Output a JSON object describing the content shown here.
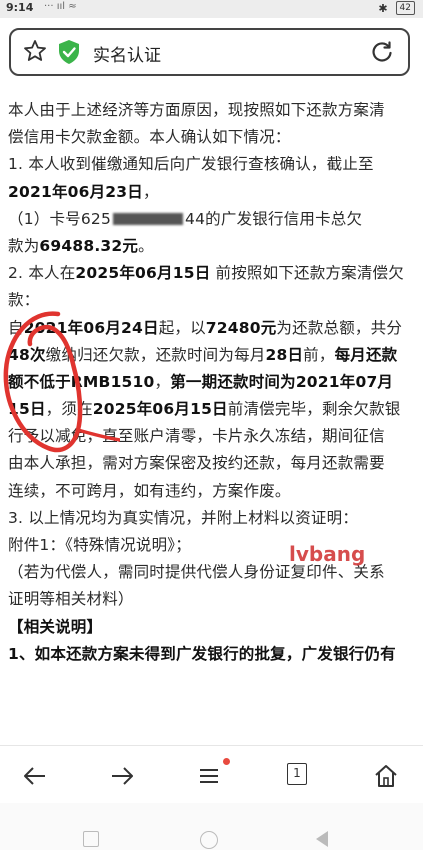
{
  "status_bar": {
    "time": "9:14",
    "signal": "··· ııl ≈",
    "battery": "42"
  },
  "address_bar": {
    "title": "实名认证",
    "shield_color": "#3bb44a"
  },
  "content": {
    "lines": [
      [
        {
          "t": "本人由于上述经济等方面原因，现按照如下还款方案清"
        }
      ],
      [
        {
          "t": "偿信用卡欠款金额。本人确认如下情况："
        }
      ],
      [
        {
          "t": "1. 本人收到催缴通知后向广发银行查核确认，截止至"
        }
      ],
      [
        {
          "t": "2021年06月23日",
          "b": true
        },
        {
          "t": "，"
        }
      ],
      [
        {
          "t": "（1）卡号625"
        },
        {
          "redact": true
        },
        {
          "t": "44的广发银行信用卡总欠"
        }
      ],
      [
        {
          "t": "款为"
        },
        {
          "t": "69488.32元",
          "b": true
        },
        {
          "t": "。"
        }
      ],
      [
        {
          "t": "2. 本人在"
        },
        {
          "t": "2025年06月15日",
          "b": true
        },
        {
          "t": " 前按照如下还款方案清偿欠"
        }
      ],
      [
        {
          "t": "款："
        }
      ],
      [
        {
          "t": "自"
        },
        {
          "t": "2021年06月24日",
          "b": true
        },
        {
          "t": "起，以"
        },
        {
          "t": "72480元",
          "b": true
        },
        {
          "t": "为还款总额，共分"
        }
      ],
      [
        {
          "t": "48次",
          "b": true
        },
        {
          "t": "缴纳归还欠款，还款时间为每月"
        },
        {
          "t": "28日",
          "b": true
        },
        {
          "t": "前，"
        },
        {
          "t": "每月还款",
          "b": true
        }
      ],
      [
        {
          "t": "额不低于RMB1510",
          "b": true
        },
        {
          "t": "，"
        },
        {
          "t": "第一期还款时间为2021年07月",
          "b": true
        }
      ],
      [
        {
          "t": "15日",
          "b": true
        },
        {
          "t": "，须在"
        },
        {
          "t": "2025年06月15日",
          "b": true
        },
        {
          "t": "前清偿完毕，剩余欠款银"
        }
      ],
      [
        {
          "t": "行予以减免，直至账户清零，卡片永久冻结，期间征信"
        }
      ],
      [
        {
          "t": "由本人承担，需对方案保密及按约还款，每月还款需要"
        }
      ],
      [
        {
          "t": "连续，不可跨月，如有违约，方案作废。"
        }
      ],
      [
        {
          "t": "3. 以上情况均为真实情况，并附上材料以资证明："
        }
      ],
      [
        {
          "t": "附件1：《特殊情况说明》；"
        }
      ],
      [
        {
          "t": "（若为代偿人，需同时提供代偿人身份证复印件、关系"
        }
      ],
      [
        {
          "t": "证明等相关材料）"
        }
      ],
      [
        {
          "t": "【相关说明】",
          "b": true
        }
      ],
      [
        {
          "t": "1、如本还款方案未得到广发银行的批复，广发银行仍有",
          "b": true
        }
      ]
    ]
  },
  "watermark": {
    "text": "lvbang",
    "color": "#d23a3a"
  },
  "annotation_color": "#e0342f",
  "toolbar": {
    "icons": [
      "back-arrow-icon",
      "forward-arrow-icon",
      "menu-icon",
      "tabs-icon",
      "home-icon"
    ],
    "tab_count": "1",
    "badge_color": "#e84a3f"
  }
}
